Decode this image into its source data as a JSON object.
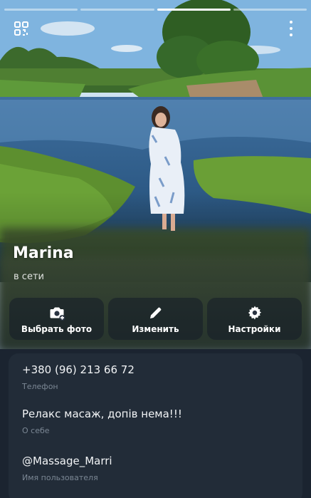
{
  "profile": {
    "name": "Marina",
    "status": "в сети"
  },
  "story_bars": [
    {
      "active": false
    },
    {
      "active": false
    },
    {
      "active": true
    },
    {
      "active": false
    }
  ],
  "actions": [
    {
      "label": "Выбрать фото",
      "icon": "camera-add-icon"
    },
    {
      "label": "Изменить",
      "icon": "pencil-icon"
    },
    {
      "label": "Настройки",
      "icon": "gear-icon"
    }
  ],
  "info": [
    {
      "value": "+380 (96) 213 66 72",
      "label": "Телефон"
    },
    {
      "value": "Релакс масаж, допів нема!!!",
      "label": "О себе"
    },
    {
      "value": "@Massage_Marri",
      "label": "Имя пользователя"
    }
  ],
  "header_icons": {
    "left": "qr-code-icon",
    "right": "more-vertical-icon"
  },
  "colors": {
    "background": "#1b2430",
    "card": "#222c38",
    "label": "#7b8794"
  }
}
